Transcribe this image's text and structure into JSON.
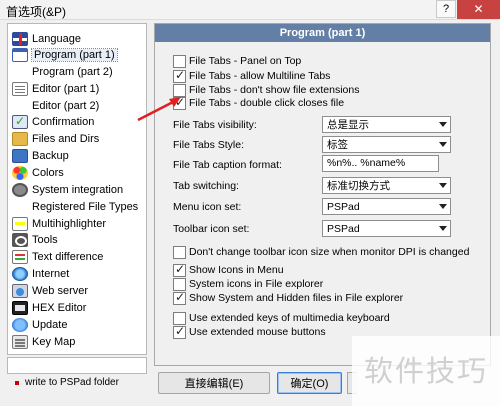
{
  "window": {
    "title": "首选项(&P)",
    "help_label": "?",
    "close_label": "✕"
  },
  "tree": {
    "items": [
      {
        "label": "Language",
        "icon": "flag-icon"
      },
      {
        "label": "Program  (part 1)",
        "icon": "program-icon",
        "selected": true
      },
      {
        "label": "Program  (part 2)",
        "icon": null
      },
      {
        "label": "Editor  (part 1)",
        "icon": "document-icon"
      },
      {
        "label": "Editor  (part 2)",
        "icon": null
      },
      {
        "label": "Confirmation",
        "icon": "checklist-icon"
      },
      {
        "label": "Files and Dirs",
        "icon": "folder-icon"
      },
      {
        "label": "Backup",
        "icon": "backup-icon"
      },
      {
        "label": "Colors",
        "icon": "colors-icon"
      },
      {
        "label": "System integration",
        "icon": "gear-icon"
      },
      {
        "label": "Registered File Types",
        "icon": null
      },
      {
        "label": "Multihighlighter",
        "icon": "highlighter-icon"
      },
      {
        "label": "Tools",
        "icon": "tools-icon"
      },
      {
        "label": "Text difference",
        "icon": "text-diff-icon"
      },
      {
        "label": "Internet",
        "icon": "globe-icon"
      },
      {
        "label": "Web server",
        "icon": "web-server-icon"
      },
      {
        "label": "HEX Editor",
        "icon": "hex-editor-icon"
      },
      {
        "label": "Update",
        "icon": "update-icon"
      },
      {
        "label": "Key Map",
        "icon": "keymap-icon"
      }
    ],
    "write_note": "write to PSPad folder"
  },
  "panel": {
    "header": "Program  (part 1)",
    "tab_checkboxes": [
      {
        "label": "File Tabs - Panel on Top",
        "checked": false
      },
      {
        "label": "File Tabs - allow Multiline Tabs",
        "checked": true
      },
      {
        "label": "File Tabs - don't show file extensions",
        "checked": false
      },
      {
        "label": "File Tabs - double click closes file",
        "checked": true
      }
    ],
    "fields": {
      "tabs_visibility": {
        "label": "File Tabs visibility:",
        "value": "总是显示"
      },
      "tabs_style": {
        "label": "File Tabs Style:",
        "value": "标签"
      },
      "caption_format": {
        "label": "File Tab caption format:",
        "value": "%n%.. %name%"
      },
      "tab_switching": {
        "label": "Tab switching:",
        "value": "标准切换方式"
      },
      "menu_icon_set": {
        "label": "Menu icon set:",
        "value": "PSPad"
      },
      "toolbar_icon_set": {
        "label": "Toolbar icon set:",
        "value": "PSPad"
      }
    },
    "dpi_checkbox": {
      "label": "Don't change toolbar icon size when monitor DPI is changed",
      "checked": false
    },
    "explorer_checkboxes": [
      {
        "label": "Show Icons in Menu",
        "checked": true
      },
      {
        "label": "System icons in File explorer",
        "checked": false
      },
      {
        "label": "Show System and Hidden files in File explorer",
        "checked": true
      }
    ],
    "input_checkboxes": [
      {
        "label": "Use extended keys of multimedia keyboard",
        "checked": false
      },
      {
        "label": "Use extended mouse buttons",
        "checked": true
      }
    ]
  },
  "buttons": {
    "direct_edit": "直接编辑(E)",
    "ok": "确定(O)"
  },
  "watermark": "软件技巧"
}
